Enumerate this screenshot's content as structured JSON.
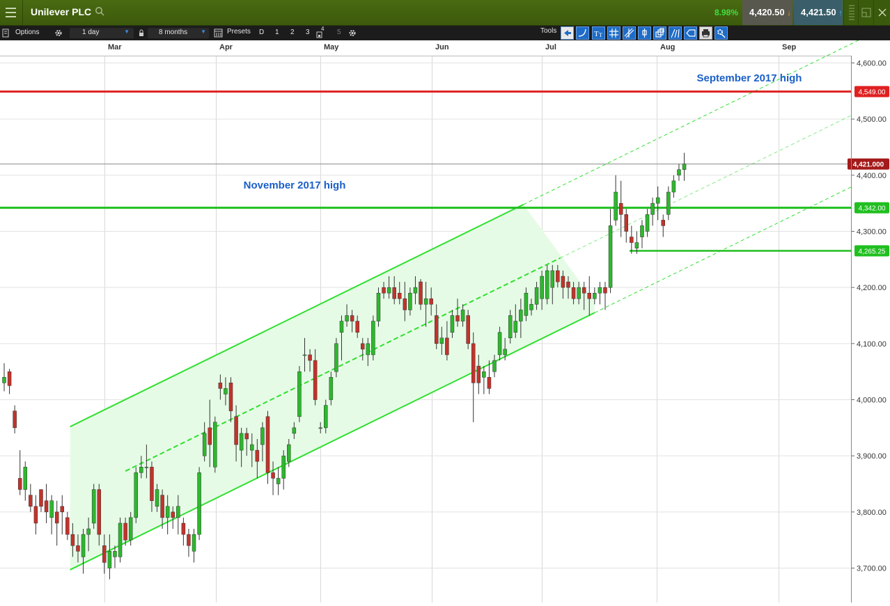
{
  "app": {
    "instrument": "Unilever PLC",
    "change_pct": "8.98%",
    "sell_price": "4,420.50",
    "buy_price": "4,421.50"
  },
  "toolbar": {
    "options_label": "Options",
    "interval_value": "1 day",
    "range_value": "8 months",
    "presets_label": "Presets",
    "preset_items": [
      "D",
      "1",
      "2",
      "3",
      "4",
      "5"
    ],
    "tools_label": "Tools"
  },
  "colors": {
    "up_candle": "#2db82d",
    "down_candle": "#c2332b",
    "resistance_red": "#e02020",
    "support_green": "#1fbf1f",
    "channel_line": "#2ee02e",
    "channel_fill": "#e6fbe6",
    "annotation_blue": "#1a5fc8"
  },
  "chart_data": {
    "type": "candlestick",
    "x_ticks": [
      "Mar",
      "Apr",
      "May",
      "Jun",
      "Jul",
      "Aug",
      "Sep"
    ],
    "y_ticks": [
      "4,600.00",
      "4,500.00",
      "4,400.00",
      "4,300.00",
      "4,200.00",
      "4,100.00",
      "4,000.00",
      "3,900.00",
      "3,800.00",
      "3,700.00"
    ],
    "ylim": [
      3660,
      4620
    ],
    "last_price_label": "4,421.000",
    "horizontal_levels": [
      {
        "value": 4549,
        "label": "4,549.00",
        "color": "#e02020"
      },
      {
        "value": 4342,
        "label": "4,342.00",
        "color": "#1fbf1f"
      },
      {
        "value": 4265.25,
        "label": "4,265.25",
        "color": "#1fbf1f"
      }
    ],
    "annotations": [
      "September 2017 high",
      "November 2017 high"
    ],
    "channel": {
      "start_day": 12.5,
      "end_day": 112,
      "lower_start": 3697,
      "lower_end": 4155,
      "upper_offset": 255
    },
    "candles": [
      [
        0,
        4030,
        4065,
        4015,
        4040
      ],
      [
        1,
        4050,
        4055,
        4010,
        4025
      ],
      [
        2,
        3980,
        3990,
        3940,
        3950
      ],
      [
        3,
        3860,
        3910,
        3830,
        3840
      ],
      [
        4,
        3840,
        3890,
        3820,
        3880
      ],
      [
        5,
        3830,
        3850,
        3800,
        3810
      ],
      [
        6,
        3810,
        3830,
        3760,
        3780
      ],
      [
        7,
        3840,
        3840,
        3800,
        3810
      ],
      [
        8,
        3820,
        3850,
        3780,
        3800
      ],
      [
        9,
        3790,
        3830,
        3760,
        3820
      ],
      [
        10,
        3800,
        3820,
        3740,
        3780
      ],
      [
        11,
        3810,
        3830,
        3760,
        3800
      ],
      [
        12,
        3790,
        3800,
        3750,
        3760
      ],
      [
        13,
        3760,
        3780,
        3720,
        3740
      ],
      [
        14,
        3740,
        3760,
        3710,
        3730
      ],
      [
        15,
        3720,
        3770,
        3690,
        3760
      ],
      [
        16,
        3760,
        3790,
        3730,
        3770
      ],
      [
        17,
        3780,
        3850,
        3770,
        3840
      ],
      [
        18,
        3840,
        3850,
        3740,
        3760
      ],
      [
        19,
        3740,
        3760,
        3690,
        3710
      ],
      [
        20,
        3700,
        3760,
        3680,
        3730
      ],
      [
        21,
        3720,
        3740,
        3700,
        3730
      ],
      [
        22,
        3720,
        3790,
        3710,
        3780
      ],
      [
        23,
        3780,
        3790,
        3740,
        3750
      ],
      [
        24,
        3750,
        3800,
        3740,
        3790
      ],
      [
        25,
        3790,
        3880,
        3780,
        3870
      ],
      [
        26,
        3870,
        3900,
        3860,
        3880
      ],
      [
        27,
        3880,
        3920,
        3860,
        3880
      ],
      [
        28,
        3880,
        3890,
        3800,
        3820
      ],
      [
        29,
        3810,
        3850,
        3800,
        3840
      ],
      [
        30,
        3830,
        3840,
        3770,
        3790
      ],
      [
        31,
        3790,
        3830,
        3760,
        3810
      ],
      [
        32,
        3800,
        3810,
        3770,
        3790
      ],
      [
        33,
        3790,
        3830,
        3760,
        3810
      ],
      [
        34,
        3780,
        3790,
        3740,
        3760
      ],
      [
        35,
        3760,
        3770,
        3720,
        3740
      ],
      [
        36,
        3730,
        3770,
        3710,
        3760
      ],
      [
        37,
        3760,
        3880,
        3750,
        3870
      ],
      [
        38,
        3900,
        3960,
        3890,
        3940
      ],
      [
        39,
        3950,
        4000,
        3880,
        3920
      ],
      [
        40,
        3880,
        3970,
        3870,
        3960
      ],
      [
        41,
        4030,
        4045,
        4000,
        4020
      ],
      [
        42,
        4010,
        4040,
        3990,
        4020
      ],
      [
        43,
        4030,
        4040,
        3960,
        3980
      ],
      [
        44,
        3970,
        3990,
        3890,
        3920
      ],
      [
        45,
        3910,
        3950,
        3880,
        3940
      ],
      [
        46,
        3940,
        3950,
        3900,
        3930
      ],
      [
        47,
        3910,
        3940,
        3880,
        3920
      ],
      [
        48,
        3910,
        3930,
        3860,
        3890
      ],
      [
        49,
        3920,
        3960,
        3890,
        3950
      ],
      [
        50,
        3970,
        3980,
        3850,
        3870
      ],
      [
        51,
        3870,
        3890,
        3830,
        3860
      ],
      [
        52,
        3850,
        3880,
        3830,
        3860
      ],
      [
        53,
        3860,
        3910,
        3840,
        3900
      ],
      [
        54,
        3890,
        3930,
        3880,
        3920
      ],
      [
        55,
        3940,
        3960,
        3930,
        3950
      ],
      [
        56,
        3970,
        4060,
        3960,
        4050
      ],
      [
        57,
        4080,
        4110,
        4050,
        4080
      ],
      [
        58,
        4080,
        4090,
        4050,
        4070
      ],
      [
        59,
        4070,
        4090,
        3990,
        4000
      ],
      [
        60,
        3950,
        3960,
        3940,
        3950
      ],
      [
        61,
        3950,
        4000,
        3940,
        3990
      ],
      [
        62,
        4000,
        4050,
        3990,
        4040
      ],
      [
        63,
        4050,
        4110,
        4040,
        4100
      ],
      [
        64,
        4120,
        4150,
        4070,
        4140
      ],
      [
        65,
        4140,
        4170,
        4130,
        4150
      ],
      [
        66,
        4150,
        4160,
        4120,
        4140
      ],
      [
        67,
        4140,
        4150,
        4110,
        4120
      ],
      [
        68,
        4100,
        4110,
        4070,
        4090
      ],
      [
        69,
        4080,
        4110,
        4060,
        4100
      ],
      [
        70,
        4080,
        4150,
        4070,
        4140
      ],
      [
        71,
        4140,
        4200,
        4130,
        4190
      ],
      [
        72,
        4200,
        4210,
        4180,
        4190
      ],
      [
        73,
        4190,
        4220,
        4180,
        4200
      ],
      [
        74,
        4200,
        4220,
        4170,
        4180
      ],
      [
        75,
        4190,
        4210,
        4170,
        4180
      ],
      [
        76,
        4180,
        4210,
        4140,
        4160
      ],
      [
        77,
        4160,
        4200,
        4150,
        4190
      ],
      [
        78,
        4190,
        4220,
        4170,
        4200
      ],
      [
        79,
        4210,
        4215,
        4160,
        4170
      ],
      [
        80,
        4170,
        4210,
        4130,
        4180
      ],
      [
        81,
        4180,
        4200,
        4150,
        4170
      ],
      [
        82,
        4150,
        4170,
        4090,
        4100
      ],
      [
        83,
        4100,
        4130,
        4080,
        4110
      ],
      [
        84,
        4110,
        4140,
        4070,
        4080
      ],
      [
        85,
        4120,
        4160,
        4110,
        4150
      ],
      [
        86,
        4150,
        4180,
        4130,
        4140
      ],
      [
        87,
        4140,
        4170,
        4130,
        4160
      ],
      [
        88,
        4150,
        4160,
        4090,
        4100
      ],
      [
        89,
        4100,
        4120,
        3960,
        4030
      ],
      [
        90,
        4060,
        4080,
        4010,
        4030
      ],
      [
        91,
        4040,
        4060,
        4010,
        4050
      ],
      [
        92,
        4040,
        4070,
        4010,
        4020
      ],
      [
        93,
        4050,
        4080,
        4040,
        4070
      ],
      [
        94,
        4080,
        4130,
        4070,
        4120
      ],
      [
        95,
        4080,
        4110,
        4070,
        4090
      ],
      [
        96,
        4110,
        4160,
        4100,
        4150
      ],
      [
        97,
        4120,
        4170,
        4110,
        4140
      ],
      [
        98,
        4140,
        4180,
        4110,
        4160
      ],
      [
        99,
        4150,
        4200,
        4140,
        4190
      ],
      [
        100,
        4160,
        4180,
        4150,
        4170
      ],
      [
        101,
        4170,
        4210,
        4160,
        4200
      ],
      [
        102,
        4180,
        4230,
        4160,
        4220
      ],
      [
        103,
        4180,
        4240,
        4170,
        4230
      ],
      [
        104,
        4200,
        4240,
        4170,
        4230
      ],
      [
        105,
        4230,
        4240,
        4200,
        4210
      ],
      [
        106,
        4220,
        4230,
        4180,
        4200
      ],
      [
        107,
        4210,
        4220,
        4180,
        4200
      ],
      [
        108,
        4200,
        4210,
        4170,
        4180
      ],
      [
        109,
        4180,
        4210,
        4170,
        4200
      ],
      [
        110,
        4200,
        4210,
        4160,
        4190
      ],
      [
        111,
        4190,
        4220,
        4150,
        4180
      ],
      [
        112,
        4180,
        4200,
        4170,
        4190
      ],
      [
        113,
        4190,
        4210,
        4170,
        4200
      ],
      [
        114,
        4200,
        4210,
        4160,
        4190
      ],
      [
        115,
        4200,
        4340,
        4190,
        4310
      ],
      [
        116,
        4320,
        4400,
        4310,
        4370
      ],
      [
        117,
        4350,
        4390,
        4290,
        4330
      ],
      [
        118,
        4330,
        4340,
        4280,
        4300
      ],
      [
        119,
        4290,
        4310,
        4260,
        4280
      ],
      [
        120,
        4270,
        4300,
        4260,
        4280
      ],
      [
        121,
        4290,
        4320,
        4270,
        4310
      ],
      [
        122,
        4300,
        4340,
        4290,
        4330
      ],
      [
        123,
        4330,
        4360,
        4310,
        4350
      ],
      [
        124,
        4350,
        4380,
        4320,
        4360
      ],
      [
        125,
        4320,
        4330,
        4290,
        4310
      ],
      [
        126,
        4330,
        4380,
        4320,
        4370
      ],
      [
        127,
        4370,
        4400,
        4360,
        4390
      ],
      [
        128,
        4400,
        4420,
        4390,
        4410
      ],
      [
        129,
        4410,
        4440,
        4390,
        4420
      ]
    ]
  }
}
